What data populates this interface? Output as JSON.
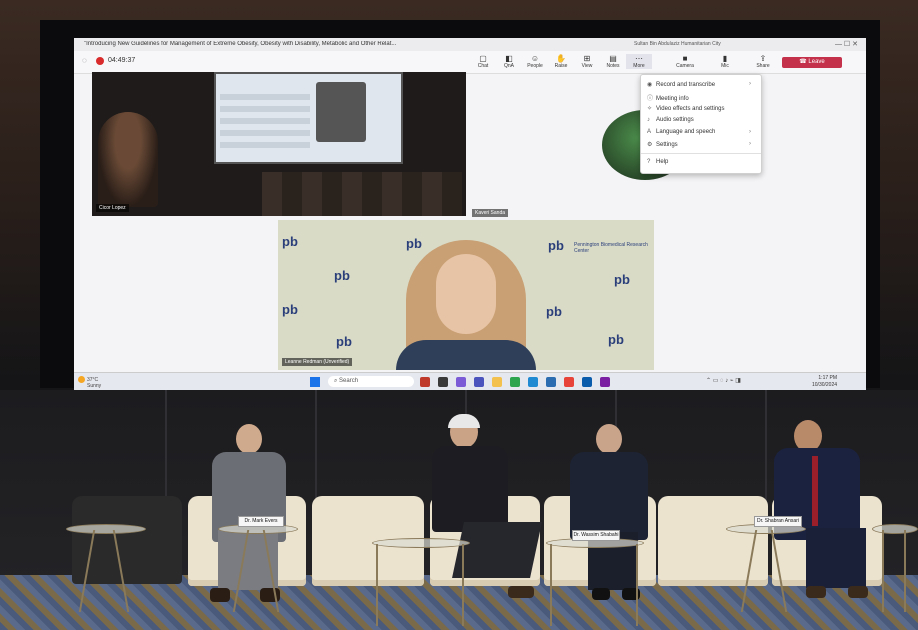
{
  "meeting": {
    "window_title": "\"Introducing New Guidelines for Management of Extreme Obesity, Obesity with Disability, Metabolic and Other Relat...",
    "host_name": "Sultan Bin Abdulaziz Humanitarian City",
    "timer": "04:49:37",
    "toolbar": [
      {
        "label": "Chat",
        "icon": "chat-icon"
      },
      {
        "label": "QnA",
        "icon": "qna-icon"
      },
      {
        "label": "People",
        "icon": "people-icon"
      },
      {
        "label": "Raise",
        "icon": "hand-icon"
      },
      {
        "label": "View",
        "icon": "view-icon"
      },
      {
        "label": "Notes",
        "icon": "notes-icon"
      },
      {
        "label": "More",
        "icon": "more-icon"
      },
      {
        "label": "Camera",
        "icon": "camera-icon"
      },
      {
        "label": "Mic",
        "icon": "mic-icon"
      },
      {
        "label": "Share",
        "icon": "share-icon"
      }
    ],
    "leave_label": "Leave",
    "participants": {
      "tile1_name": "Cicor Lopez",
      "tile2_name": "Kaveri Sanda",
      "speaker_name": "Leanne Redman (Unverified)"
    },
    "more_menu": [
      {
        "label": "Record and transcribe",
        "icon": "record-icon",
        "submenu": true
      },
      {
        "label": "Meeting info",
        "icon": "info-icon",
        "submenu": false
      },
      {
        "label": "Video effects and settings",
        "icon": "effects-icon",
        "submenu": false
      },
      {
        "label": "Audio settings",
        "icon": "audio-icon",
        "submenu": false
      },
      {
        "label": "Language and speech",
        "icon": "language-icon",
        "submenu": true
      },
      {
        "label": "Settings",
        "icon": "gear-icon",
        "submenu": true
      },
      {
        "label": "Help",
        "icon": "help-icon",
        "submenu": false
      }
    ],
    "background_brand": "pb",
    "background_brand_sub": "Pennington Biomedical Research Center"
  },
  "taskbar": {
    "weather_temp": "37°C",
    "weather_desc": "Sunny",
    "search_label": "Search",
    "time": "1:17 PM",
    "date": "10/30/2024"
  },
  "panel": {
    "nameplates": [
      "Dr. Mark Evers",
      "Dr. Wassim Shabahi",
      "Dr. Shabran Ansari"
    ]
  },
  "colors": {
    "leave_red": "#c4314b",
    "record_red": "#d92b2b",
    "brand_blue": "#2b3f7a"
  }
}
